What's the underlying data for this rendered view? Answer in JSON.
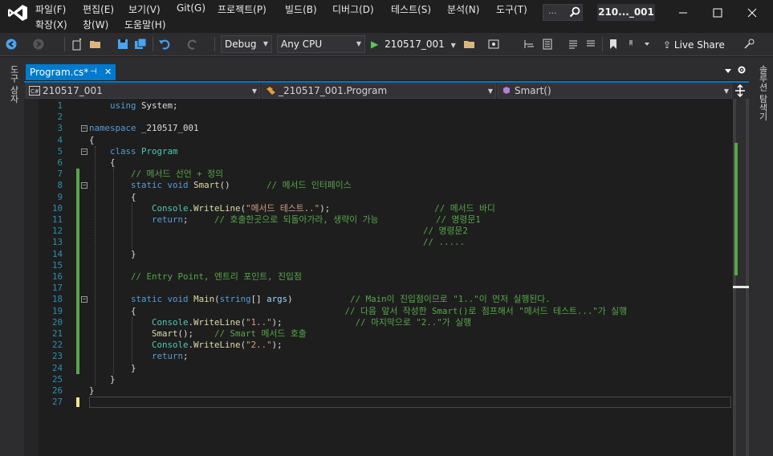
{
  "menu": {
    "items": [
      "파일(F)",
      "편집(E)",
      "보기(V)",
      "Git(G)",
      "프로젝트(P)",
      "빌드(B)",
      "디버그(D)",
      "테스트(S)",
      "분석(N)",
      "도구(T)"
    ],
    "items_row2": [
      "확장(X)",
      "창(W)",
      "도움말(H)"
    ],
    "search_placeholder": "...",
    "solution_name": "210..._001"
  },
  "toolbar": {
    "configuration": "Debug",
    "platform": "Any CPU",
    "run_target": "210517_001",
    "live_share": "Live Share"
  },
  "side_tabs": {
    "left": "도구 상자",
    "right": "솔루션 탐색기"
  },
  "tab": {
    "label": "Program.cs*",
    "pin": "⊣",
    "close": "✕"
  },
  "navbar": {
    "project": "210517_001",
    "class": "_210517_001.Program",
    "member": "Smart()"
  },
  "editor": {
    "lines": [
      {
        "n": "1",
        "html": "    <span class='kw'>using</span> System;"
      },
      {
        "n": "2",
        "html": ""
      },
      {
        "n": "3",
        "html": "<span class='kw'>namespace</span> _210517_001"
      },
      {
        "n": "4",
        "html": "{"
      },
      {
        "n": "5",
        "html": "    <span class='kw'>class</span> <span class='ty'>Program</span>"
      },
      {
        "n": "6",
        "html": "    {"
      },
      {
        "n": "7",
        "html": "        <span class='cm'>// 메서드 선언 + 정의</span>"
      },
      {
        "n": "8",
        "html": "        <span class='kw'>static</span> <span class='kw'>void</span> <span class='mt'>Smart</span>()       <span class='cm'>// 메서드 인터페이스</span>"
      },
      {
        "n": "9",
        "html": "        {"
      },
      {
        "n": "10",
        "html": "            <span class='ty'>Console</span>.<span class='mt'>WriteLine</span>(<span class='st'>\"메서드 테스트..\"</span>);                    <span class='cm'>// 메서드 바디</span>"
      },
      {
        "n": "11",
        "html": "            <span class='kw'>return</span>;     <span class='cm'>// 호출한곳으로 되돌아가라, 생략이 가능</span>           <span class='cm'>// 명령문1</span>"
      },
      {
        "n": "12",
        "html": "                                                                <span class='cm'>// 명령문2</span>"
      },
      {
        "n": "13",
        "html": "                                                                <span class='cm'>// .....</span>"
      },
      {
        "n": "14",
        "html": "        }"
      },
      {
        "n": "15",
        "html": ""
      },
      {
        "n": "16",
        "html": "        <span class='cm'>// Entry Point, 엔트리 포인트, 진입점</span>"
      },
      {
        "n": "17",
        "html": ""
      },
      {
        "n": "18",
        "html": "        <span class='kw'>static</span> <span class='kw'>void</span> <span class='mt'>Main</span>(<span class='kw'>string</span>[] <span class='pm'>args</span>)           <span class='cm'>// Main이 진입점이므로 \"1..\"이 먼저 실행된다.</span>"
      },
      {
        "n": "19",
        "html": "        {                                        <span class='cm'>// 다음 앞서 작성한 Smart()로 점프해서 \"메서드 테스트...\"가 실행</span>"
      },
      {
        "n": "20",
        "html": "            <span class='ty'>Console</span>.<span class='mt'>WriteLine</span>(<span class='st'>\"1..\"</span>);              <span class='cm'>// 마지막으로 \"2..\"가 실행</span>"
      },
      {
        "n": "21",
        "html": "            <span class='mt'>Smart</span>();    <span class='cm'>// Smart 메서드 호출</span>"
      },
      {
        "n": "22",
        "html": "            <span class='ty'>Console</span>.<span class='mt'>WriteLine</span>(<span class='st'>\"2..\"</span>);"
      },
      {
        "n": "23",
        "html": "            <span class='kw'>return</span>;"
      },
      {
        "n": "24",
        "html": "        }"
      },
      {
        "n": "25",
        "html": "    }"
      },
      {
        "n": "26",
        "html": "}"
      },
      {
        "n": "27",
        "html": ""
      }
    ]
  }
}
